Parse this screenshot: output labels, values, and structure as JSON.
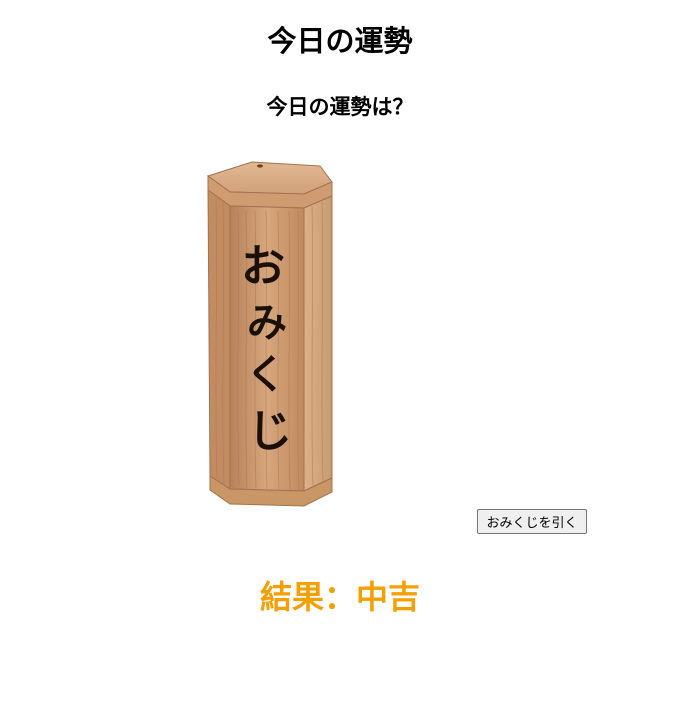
{
  "header": {
    "title": "今日の運勢",
    "subtitle": "今日の運勢は？"
  },
  "omikuji": {
    "box_text": [
      "お",
      "み",
      "く",
      "じ"
    ],
    "icon": "omikuji-box-icon",
    "wood_color": "#c8946a",
    "ink_color": "#1a1008"
  },
  "controls": {
    "draw_button_label": "おみくじを引く"
  },
  "result": {
    "label": "結果",
    "separator": "：",
    "value": "中吉",
    "color": "#f5a000"
  }
}
